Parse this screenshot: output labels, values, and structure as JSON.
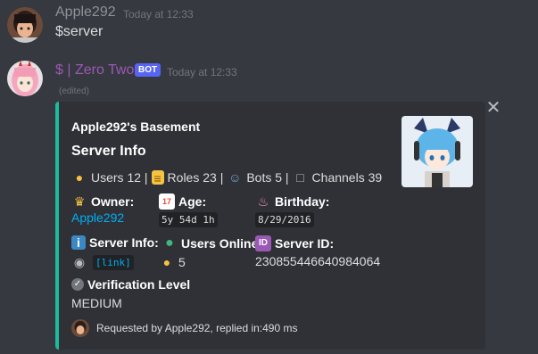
{
  "messages": [
    {
      "author": "Apple292",
      "author_color": "#8e9297",
      "timestamp": "Today at 12:33",
      "content": "$server"
    },
    {
      "author": "$ | Zero Two",
      "author_color": "#9b59b6",
      "bot_tag": "BOT",
      "timestamp": "Today at 12:33",
      "edited": "(edited)"
    }
  ],
  "embed": {
    "accent_color": "#1abc9c",
    "author": "Apple292's Basement",
    "title": "Server Info",
    "stats": {
      "users": "Users 12 |",
      "roles": "Roles 23 |",
      "bots": "Bots 5 |",
      "channels": "Channels 39"
    },
    "fields": {
      "owner_name": "Owner:",
      "owner_value": "Apple292",
      "age_name": "Age:",
      "age_value": "5y 54d 1h",
      "birthday_name": "Birthday:",
      "birthday_value": "8/29/2016",
      "server_info_name": "Server Info:",
      "server_info_value": "[link]",
      "users_online_name": "Users Online:",
      "users_online_value": "5",
      "server_id_name": "Server ID:",
      "server_id_value": "230855446640984064",
      "verification_name": "Verification Level",
      "verification_value": "MEDIUM"
    },
    "footer": "Requested by Apple292, replied in:490 ms"
  },
  "icons": {
    "user": "person-icon",
    "roles": "scroll-icon",
    "bots": "robot-icon",
    "channels": "speech-bubble-icon",
    "owner": "crown-icon",
    "age": "calendar-icon",
    "birthday": "cake-icon",
    "server_info": "info-icon",
    "users_online": "green-dot-icon",
    "server_id": "id-icon",
    "verification": "check-badge-icon",
    "close": "close-icon"
  }
}
